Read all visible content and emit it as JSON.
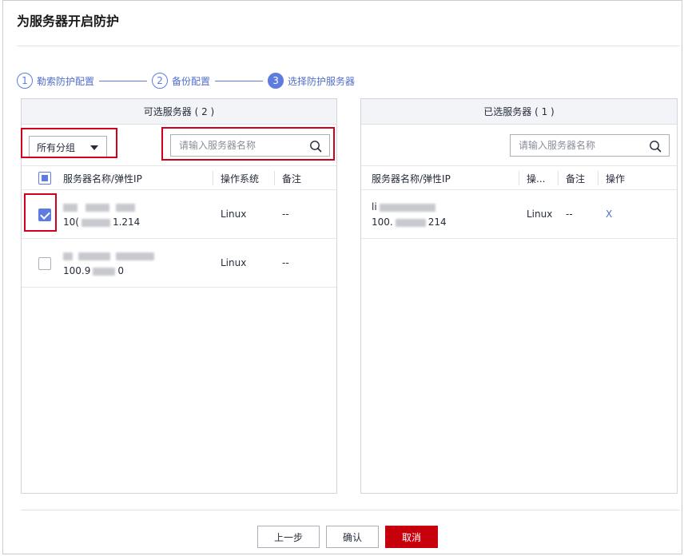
{
  "dialog": {
    "title": "为服务器开启防护"
  },
  "steps": [
    {
      "num": "1",
      "label": "勒索防护配置",
      "state": "done"
    },
    {
      "num": "2",
      "label": "备份配置",
      "state": "done"
    },
    {
      "num": "3",
      "label": "选择防护服务器",
      "state": "active"
    }
  ],
  "available": {
    "title": "可选服务器 ( 2 )",
    "group_select": "所有分组",
    "search_placeholder": "请输入服务器名称",
    "columns": {
      "name_ip": "服务器名称/弹性IP",
      "os": "操作系统",
      "remark": "备注"
    },
    "rows": [
      {
        "ip_start": "10(",
        "ip_end": "1.214",
        "os": "Linux",
        "remark": "--",
        "checked": true
      },
      {
        "ip_start": "100.9",
        "ip_end": "0",
        "os": "Linux",
        "remark": "--",
        "checked": false
      }
    ]
  },
  "selected": {
    "title": "已选服务器 ( 1 )",
    "search_placeholder": "请输入服务器名称",
    "columns": {
      "name_ip": "服务器名称/弹性IP",
      "os": "操...",
      "remark": "备注",
      "action": "操作"
    },
    "rows": [
      {
        "name_start": "li",
        "ip_start": "100.",
        "ip_end": "214",
        "os": "Linux",
        "remark": "--",
        "action": "X"
      }
    ]
  },
  "footer": {
    "prev": "上一步",
    "confirm": "确认",
    "cancel": "取消"
  },
  "colors": {
    "accent": "#5e7ce0",
    "danger": "#c7000b",
    "highlight": "#d0021b"
  }
}
